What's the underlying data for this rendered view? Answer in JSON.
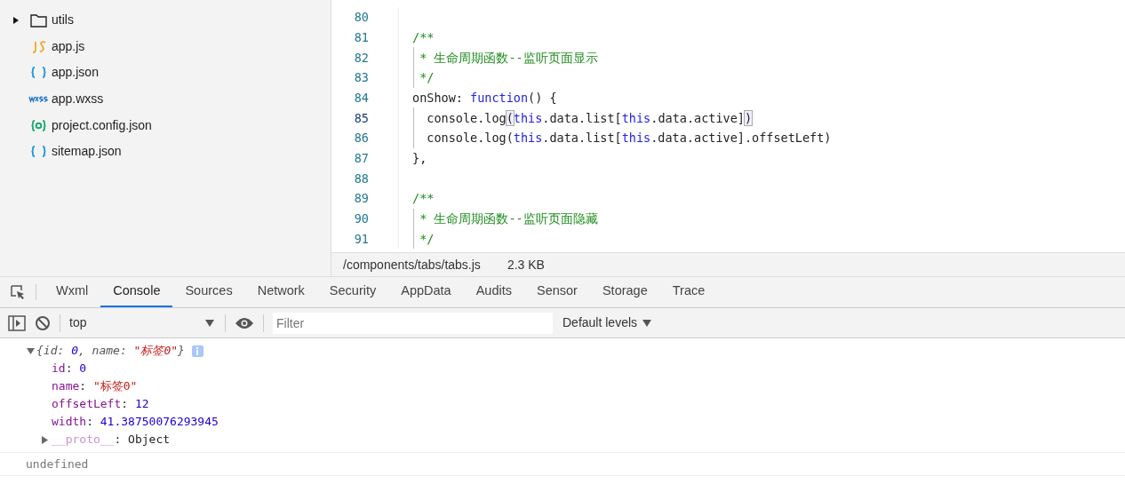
{
  "file_tree": [
    {
      "name": "utils",
      "kind": "folder",
      "expanded": false
    },
    {
      "name": "app.js",
      "kind": "js"
    },
    {
      "name": "app.json",
      "kind": "json"
    },
    {
      "name": "app.wxss",
      "kind": "wxss"
    },
    {
      "name": "project.config.json",
      "kind": "config"
    },
    {
      "name": "sitemap.json",
      "kind": "json"
    }
  ],
  "editor": {
    "lines": [
      {
        "number": "80",
        "current": false
      },
      {
        "number": "81",
        "current": false,
        "tokens": [
          {
            "text": "/**",
            "kind": "comment"
          }
        ]
      },
      {
        "number": "82",
        "current": false,
        "guide": true,
        "tokens": [
          {
            "text": " * 生命周期函数--监听页面显示",
            "kind": "comment"
          }
        ]
      },
      {
        "number": "83",
        "current": false,
        "guide": true,
        "tokens": [
          {
            "text": " */",
            "kind": "comment"
          }
        ]
      },
      {
        "number": "84",
        "current": false,
        "tokens": [
          {
            "text": "onShow: ",
            "kind": "plain"
          },
          {
            "text": "function",
            "kind": "keyword"
          },
          {
            "text": "() {",
            "kind": "plain"
          }
        ]
      },
      {
        "number": "85",
        "current": true,
        "guide": true,
        "tokens": [
          {
            "text": "  console.log",
            "kind": "plain"
          },
          {
            "text": "(",
            "kind": "match"
          },
          {
            "text": "this",
            "kind": "keyword"
          },
          {
            "text": ".data.list[",
            "kind": "plain"
          },
          {
            "text": "this",
            "kind": "keyword"
          },
          {
            "text": ".data.active]",
            "kind": "plain"
          },
          {
            "text": ")",
            "kind": "match"
          }
        ]
      },
      {
        "number": "86",
        "current": false,
        "guide": true,
        "tokens": [
          {
            "text": "  console.log(",
            "kind": "plain"
          },
          {
            "text": "this",
            "kind": "keyword"
          },
          {
            "text": ".data.list[",
            "kind": "plain"
          },
          {
            "text": "this",
            "kind": "keyword"
          },
          {
            "text": ".data.active].offsetLeft)",
            "kind": "plain"
          }
        ]
      },
      {
        "number": "87",
        "current": false,
        "tokens": [
          {
            "text": "},",
            "kind": "plain"
          }
        ]
      },
      {
        "number": "88",
        "current": false
      },
      {
        "number": "89",
        "current": false,
        "tokens": [
          {
            "text": "/**",
            "kind": "comment"
          }
        ]
      },
      {
        "number": "90",
        "current": false,
        "guide": true,
        "tokens": [
          {
            "text": " * 生命周期函数--监听页面隐藏",
            "kind": "comment"
          }
        ]
      },
      {
        "number": "91",
        "current": false,
        "guide": true,
        "tokens": [
          {
            "text": " */",
            "kind": "comment"
          }
        ]
      }
    ]
  },
  "status_bar": {
    "path": "/components/tabs/tabs.js",
    "size": "2.3 KB"
  },
  "devtools": {
    "tabs": [
      {
        "label": "Wxml",
        "selected": false
      },
      {
        "label": "Console",
        "selected": true
      },
      {
        "label": "Sources",
        "selected": false
      },
      {
        "label": "Network",
        "selected": false
      },
      {
        "label": "Security",
        "selected": false
      },
      {
        "label": "AppData",
        "selected": false
      },
      {
        "label": "Audits",
        "selected": false
      },
      {
        "label": "Sensor",
        "selected": false
      },
      {
        "label": "Storage",
        "selected": false
      },
      {
        "label": "Trace",
        "selected": false
      }
    ],
    "context": "top",
    "filter_placeholder": "Filter",
    "levels": "Default levels"
  },
  "console": {
    "entries": [
      {
        "kind": "object",
        "expanded": true,
        "preview": [
          {
            "text": "{id: ",
            "kind": "punct"
          },
          {
            "text": "0",
            "kind": "number"
          },
          {
            "text": ", name: ",
            "kind": "punct"
          },
          {
            "text": "\"标签0\"",
            "kind": "string"
          },
          {
            "text": "}",
            "kind": "punct"
          }
        ],
        "properties": [
          {
            "key": "id",
            "sep": ": ",
            "value": "0",
            "kind": "number"
          },
          {
            "key": "name",
            "sep": ": ",
            "value": "\"标签0\"",
            "kind": "string"
          },
          {
            "key": "offsetLeft",
            "sep": ": ",
            "value": "12",
            "kind": "number"
          },
          {
            "key": "width",
            "sep": ": ",
            "value": "41.38750076293945",
            "kind": "number"
          },
          {
            "key": "__proto__",
            "sep": ": ",
            "value": "Object",
            "kind": "proto",
            "expanded": false
          }
        ]
      },
      {
        "kind": "result",
        "text": "undefined"
      }
    ]
  }
}
